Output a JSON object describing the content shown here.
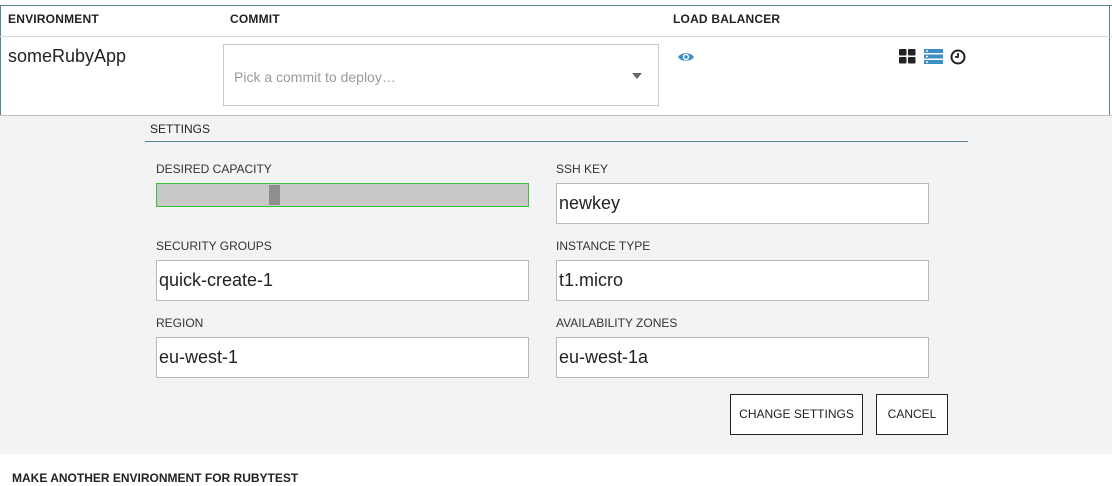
{
  "table": {
    "headers": [
      "ENVIRONMENT",
      "COMMIT",
      "LOAD BALANCER"
    ],
    "row": {
      "environment": "someRubyApp",
      "commit_placeholder": "Pick a commit to deploy…",
      "icons": [
        "eye-icon",
        "grid-view-icon",
        "list-view-icon",
        "clock-icon"
      ]
    }
  },
  "settings": {
    "title": "SETTINGS",
    "desired_capacity": {
      "label": "DESIRED CAPACITY",
      "fraction": 0.31
    },
    "ssh_key": {
      "label": "SSH KEY",
      "value": "newkey"
    },
    "security_groups": {
      "label": "SECURITY GROUPS",
      "value": "quick-create-1"
    },
    "instance_type": {
      "label": "INSTANCE TYPE",
      "value": "t1.micro"
    },
    "region": {
      "label": "REGION",
      "value": "eu-west-1"
    },
    "availability_zones": {
      "label": "AVAILABILITY ZONES",
      "value": "eu-west-1a"
    },
    "change_button": "CHANGE SETTINGS",
    "cancel_button": "CANCEL"
  },
  "footer": {
    "text": "MAKE ANOTHER ENVIRONMENT FOR RUBYTEST"
  },
  "colors": {
    "accent": "#5b7f96",
    "icon_blue": "#3b8fc4",
    "slider_border": "#39c139"
  }
}
